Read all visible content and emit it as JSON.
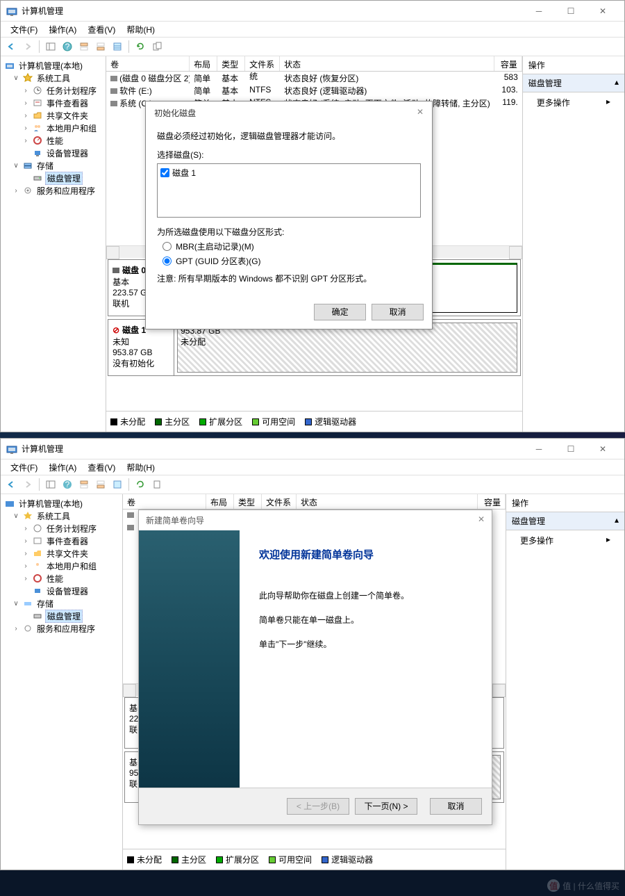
{
  "window_title": "计算机管理",
  "menus": {
    "file": "文件(F)",
    "action": "操作(A)",
    "view": "查看(V)",
    "help": "帮助(H)"
  },
  "tree": {
    "root": "计算机管理(本地)",
    "systools": "系统工具",
    "scheduler": "任务计划程序",
    "eventvwr": "事件查看器",
    "shared": "共享文件夹",
    "localusers": "本地用户和组",
    "perf": "性能",
    "devmgr": "设备管理器",
    "storage": "存储",
    "diskmgmt": "磁盘管理",
    "services": "服务和应用程序"
  },
  "listhdr": {
    "vol": "卷",
    "layout": "布局",
    "type": "类型",
    "fs": "文件系统",
    "status": "状态",
    "cap": "容量"
  },
  "volumes": [
    {
      "name": "(磁盘 0 磁盘分区 2)",
      "layout": "简单",
      "type": "基本",
      "fs": "",
      "status": "状态良好 (恢复分区)",
      "cap": "583"
    },
    {
      "name": "软件 (E:)",
      "layout": "简单",
      "type": "基本",
      "fs": "NTFS",
      "status": "状态良好 (逻辑驱动器)",
      "cap": "103."
    },
    {
      "name": "系统 (C:)",
      "layout": "简单",
      "type": "基本",
      "fs": "NTFS",
      "status": "状态良好 (系统, 启动, 页面文件, 活动, 故障转储, 主分区)",
      "cap": "119."
    }
  ],
  "disk0": {
    "name": "磁盘 0",
    "type": "基本",
    "size": "223.57 GB",
    "state": "联机"
  },
  "disk1": {
    "name": "磁盘 1",
    "type": "未知",
    "size": "953.87 GB",
    "state": "没有初始化",
    "unalloc_size": "953.87 GB",
    "unalloc_label": "未分配"
  },
  "legend": {
    "unalloc": "未分配",
    "primary": "主分区",
    "ext": "扩展分区",
    "free": "可用空间",
    "logical": "逻辑驱动器"
  },
  "actions": {
    "title": "操作",
    "section": "磁盘管理",
    "more": "更多操作"
  },
  "dlg1": {
    "title": "初始化磁盘",
    "msg": "磁盘必须经过初始化，逻辑磁盘管理器才能访问。",
    "sel": "选择磁盘(S):",
    "disk_item": "磁盘 1",
    "part_style": "为所选磁盘使用以下磁盘分区形式:",
    "mbr": "MBR(主启动记录)(M)",
    "gpt": "GPT (GUID 分区表)(G)",
    "note": "注意: 所有早期版本的 Windows 都不识别 GPT 分区形式。",
    "ok": "确定",
    "cancel": "取消"
  },
  "dlg2": {
    "title": "新建简单卷向导",
    "heading": "欢迎使用新建简单卷向导",
    "p1": "此向导帮助你在磁盘上创建一个简单卷。",
    "p2": "简单卷只能在单一磁盘上。",
    "p3": "单击\"下一步\"继续。",
    "back": "< 上一步(B)",
    "next": "下一页(N) >",
    "cancel": "取消"
  },
  "disk_panel2": {
    "base": "基",
    "size_trunc": "22",
    "state": "联",
    "base2": "基",
    "size2": "95",
    "state2": "联"
  },
  "watermark": "值 | 什么值得买"
}
